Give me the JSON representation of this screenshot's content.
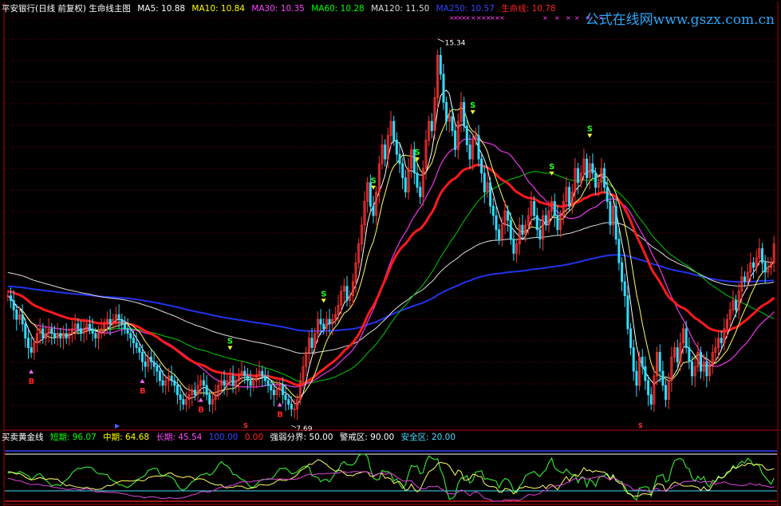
{
  "header": {
    "title": "平安银行(日线 前复权) 生命线主图",
    "indicators": [
      {
        "label": "MA5: 10.88",
        "color": "#ffffff"
      },
      {
        "label": "MA10: 10.84",
        "color": "#ffff00"
      },
      {
        "label": "MA30: 10.35",
        "color": "#ff44ff"
      },
      {
        "label": "MA60: 10.28",
        "color": "#00ff00"
      },
      {
        "label": "MA120: 11.50",
        "color": "#dddddd"
      },
      {
        "label": "MA250: 10.57",
        "color": "#3344ff"
      },
      {
        "label": "生命线: 10.78",
        "color": "#ff2222"
      }
    ]
  },
  "watermark": "公式在线网www.gszx.com.cn",
  "sub_panel": {
    "title": "买卖黄金线",
    "indicators": [
      {
        "label": "短期: 96.07",
        "color": "#00ff00"
      },
      {
        "label": "中期: 64.68",
        "color": "#ffff00"
      },
      {
        "label": "长期: 45.54",
        "color": "#ff44ff"
      },
      {
        "label": "100.00",
        "color": "#3344ff"
      },
      {
        "label": "0.00",
        "color": "#ff2222"
      },
      {
        "label": "强弱分界: 50.00",
        "color": "#ffffff"
      },
      {
        "label": "警戒区: 90.00",
        "color": "#ffffff"
      },
      {
        "label": "安全区: 20.00",
        "color": "#44ddff"
      }
    ]
  },
  "chart_data": {
    "type": "candlestick",
    "title": "平安银行(日线 前复权) 生命线主图",
    "grid": true,
    "ylim": [
      7.3,
      16.0
    ],
    "annotations": {
      "high": "15.34",
      "low": "7.69"
    },
    "signals": [
      {
        "label": "B",
        "index": 8
      },
      {
        "label": "B",
        "index": 46
      },
      {
        "label": "B",
        "index": 66
      },
      {
        "label": "B",
        "index": 93
      },
      {
        "label": "S",
        "index": 76
      },
      {
        "label": "S",
        "index": 108
      },
      {
        "label": "S",
        "index": 125
      },
      {
        "label": "S",
        "index": 140
      },
      {
        "label": "S",
        "index": 159
      },
      {
        "label": "S",
        "index": 199
      },
      {
        "label": "S",
        "index": 186
      }
    ],
    "close": [
      10.1,
      10.0,
      9.8,
      9.6,
      9.7,
      9.5,
      9.2,
      9.0,
      8.9,
      9.1,
      9.3,
      9.4,
      9.2,
      9.3,
      9.4,
      9.3,
      9.2,
      9.3,
      9.2,
      9.3,
      9.2,
      9.3,
      9.4,
      9.5,
      9.4,
      9.3,
      9.4,
      9.5,
      9.4,
      9.3,
      9.2,
      9.3,
      9.4,
      9.5,
      9.6,
      9.5,
      9.6,
      9.7,
      9.6,
      9.5,
      9.4,
      9.3,
      9.2,
      9.1,
      9.0,
      8.9,
      8.7,
      8.6,
      8.8,
      8.7,
      8.6,
      8.5,
      8.3,
      8.2,
      8.3,
      8.4,
      8.3,
      8.2,
      8.0,
      7.9,
      7.8,
      7.9,
      8.0,
      8.1,
      8.0,
      8.2,
      8.3,
      8.2,
      8.0,
      7.8,
      7.9,
      8.0,
      8.2,
      8.3,
      8.2,
      8.3,
      8.4,
      8.2,
      8.3,
      8.4,
      8.5,
      8.4,
      8.3,
      8.2,
      8.3,
      8.4,
      8.5,
      8.4,
      8.3,
      8.2,
      8.1,
      8.0,
      8.1,
      8.2,
      8.0,
      7.9,
      7.8,
      7.7,
      7.7,
      7.9,
      8.3,
      8.6,
      8.9,
      9.2,
      9.0,
      9.3,
      9.6,
      9.5,
      9.4,
      9.6,
      9.5,
      9.6,
      9.7,
      9.9,
      10.2,
      10.3,
      10.0,
      10.1,
      10.4,
      10.8,
      11.2,
      11.6,
      12.1,
      12.5,
      12.0,
      11.8,
      12.3,
      12.9,
      13.3,
      13.0,
      13.5,
      13.8,
      13.4,
      13.1,
      12.9,
      12.6,
      12.3,
      12.8,
      13.2,
      12.7,
      12.4,
      12.2,
      12.8,
      13.4,
      13.8,
      13.6,
      14.3,
      15.2,
      14.8,
      14.2,
      13.8,
      13.9,
      13.6,
      13.2,
      13.8,
      14.2,
      13.7,
      13.3,
      13.0,
      13.4,
      13.5,
      13.0,
      12.7,
      12.3,
      12.5,
      12.0,
      11.8,
      11.5,
      11.3,
      11.6,
      11.9,
      11.7,
      11.3,
      11.0,
      11.2,
      11.6,
      11.4,
      11.6,
      11.8,
      12.1,
      11.8,
      11.5,
      11.3,
      11.8,
      11.6,
      11.9,
      12.1,
      11.8,
      11.5,
      11.8,
      12.1,
      12.4,
      12.0,
      12.3,
      12.8,
      12.5,
      12.7,
      13.0,
      12.6,
      12.9,
      12.7,
      12.4,
      12.5,
      12.8,
      12.4,
      12.1,
      11.6,
      12.0,
      11.3,
      10.8,
      10.4,
      10.1,
      9.4,
      9.0,
      8.5,
      8.2,
      8.8,
      8.6,
      8.3,
      8.0,
      7.8,
      8.4,
      8.9,
      8.5,
      8.2,
      7.9,
      8.3,
      8.8,
      9.0,
      8.7,
      9.1,
      9.4,
      9.0,
      8.7,
      8.4,
      8.6,
      8.9,
      8.5,
      8.7,
      8.4,
      8.6,
      8.9,
      9.0,
      9.2,
      9.1,
      9.4,
      9.6,
      9.8,
      10.0,
      9.8,
      10.2,
      10.5,
      10.4,
      10.6,
      10.8,
      10.7,
      10.9,
      11.1,
      10.8,
      10.6,
      10.7,
      10.8,
      11.2
    ]
  }
}
